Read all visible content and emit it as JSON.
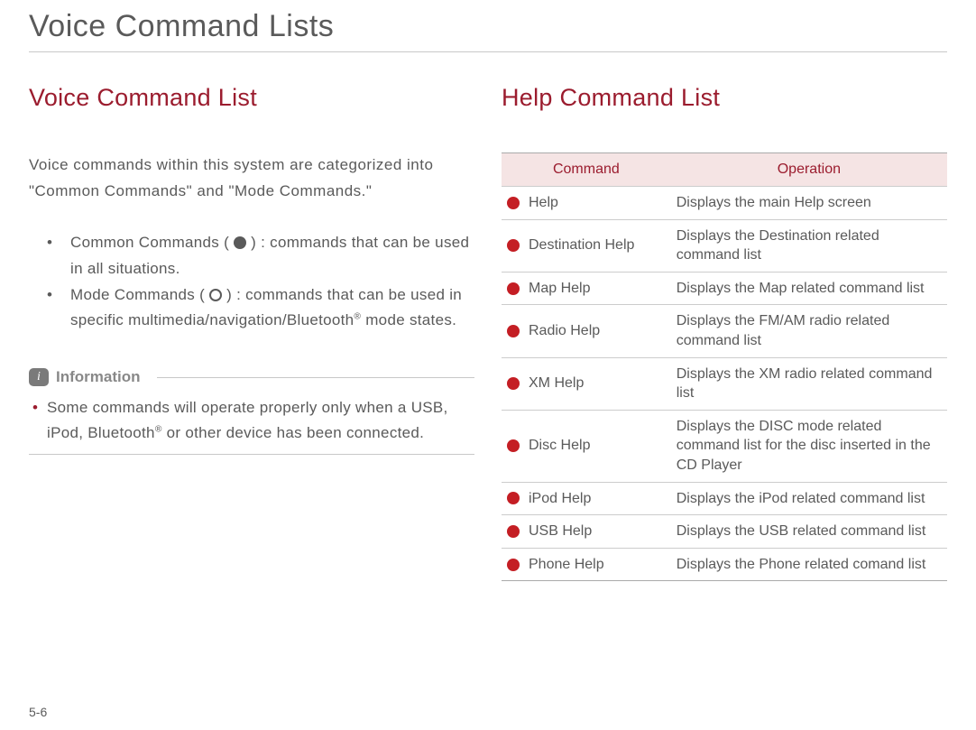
{
  "page_title": "Voice Command Lists",
  "left": {
    "heading": "Voice Command List",
    "intro": "Voice commands within this system are categorized into \"Common Commands\" and \"Mode Commands.\"",
    "bullets": {
      "common_pre": "Common Commands ( ",
      "common_post": " ) : commands that can be used in all situations.",
      "mode_pre": "Mode Commands ( ",
      "mode_post_a": " ) : commands that can be used in specific multimedia/navigation/Bluetooth",
      "mode_post_b": " mode states."
    },
    "info_label": "Information",
    "info_text_a": "Some commands will operate properly only when a USB, iPod, Bluetooth",
    "info_text_b": " or other device has been connected."
  },
  "right": {
    "heading": "Help Command List",
    "table": {
      "header_command": "Command",
      "header_operation": "Operation",
      "rows": [
        {
          "command": "Help",
          "operation": "Displays the main Help screen"
        },
        {
          "command": "Destination Help",
          "operation": "Displays the Destination related command list"
        },
        {
          "command": "Map Help",
          "operation": "Displays the Map related command list"
        },
        {
          "command": "Radio Help",
          "operation": "Displays the FM/AM radio related command list"
        },
        {
          "command": "XM Help",
          "operation": "Displays the XM radio related command list"
        },
        {
          "command": "Disc Help",
          "operation": "Displays the DISC mode related command list for the disc inserted in the CD Player"
        },
        {
          "command": "iPod Help",
          "operation": "Displays the iPod related command list"
        },
        {
          "command": "USB Help",
          "operation": "Displays the USB related command list"
        },
        {
          "command": "Phone Help",
          "operation": "Displays the Phone related comand list"
        }
      ]
    }
  },
  "page_number": "5-6"
}
